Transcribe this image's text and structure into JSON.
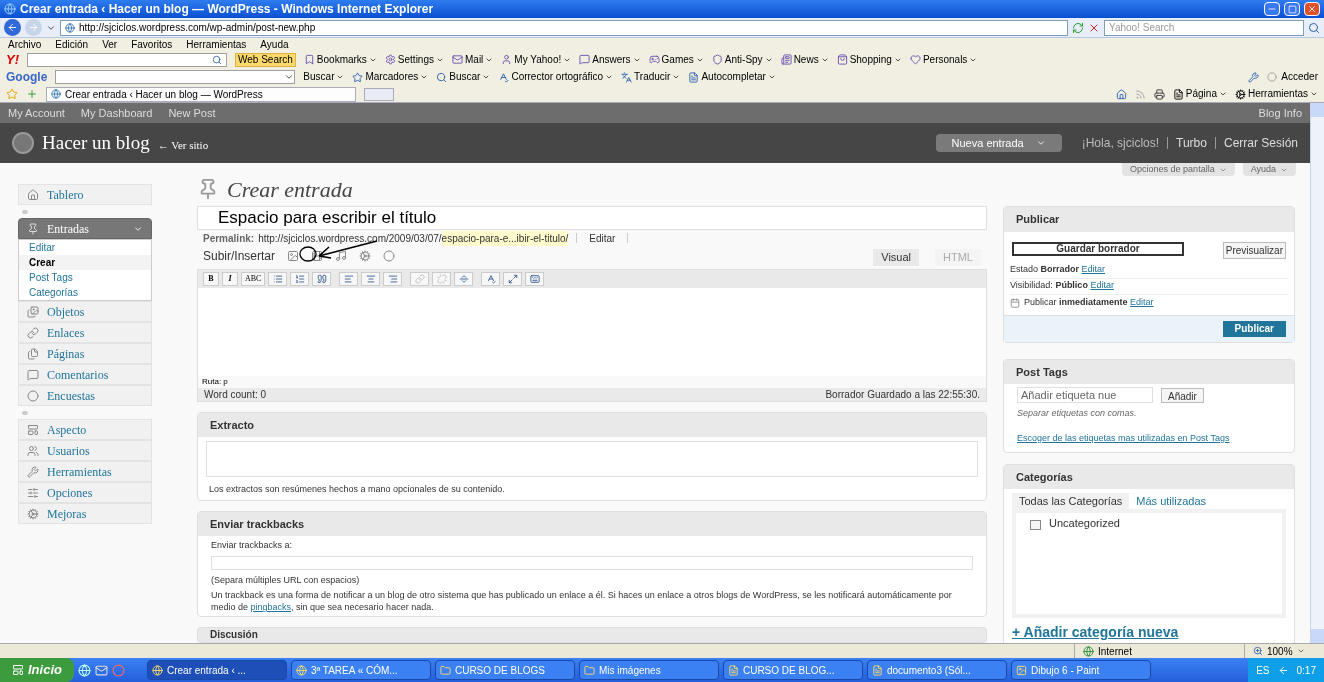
{
  "browser": {
    "title": "Crear entrada ‹ Hacer un blog — WordPress - Windows Internet Explorer",
    "address": "http://sjciclos.wordpress.com/wp-admin/post-new.php",
    "search_placeholder": "Yahoo! Search",
    "menu": [
      "Archivo",
      "Edición",
      "Ver",
      "Favoritos",
      "Herramientas",
      "Ayuda"
    ],
    "yahoo_logo": "Y!",
    "web_search": "Web Search",
    "yahoo_toolbar": [
      "Bookmarks",
      "Settings",
      "Mail",
      "My Yahoo!",
      "Answers",
      "Games",
      "Anti-Spy",
      "News",
      "Shopping",
      "Personals"
    ],
    "google_logo": "Google",
    "google_toolbar": [
      "Buscar",
      "Marcadores",
      "Buscar",
      "Corrector ortográfico",
      "Traducir",
      "Autocompletar"
    ],
    "sign_in": "Acceder",
    "tab": "Crear entrada ‹ Hacer un blog — WordPress",
    "command_bar": [
      "Página",
      "Herramientas"
    ]
  },
  "admin_bar": {
    "left": [
      "My Account",
      "My Dashboard",
      "New Post"
    ],
    "right": "Blog Info"
  },
  "header": {
    "blog_title": "Hacer un blog",
    "view_site": "← Ver sitio",
    "new_post": "Nueva entrada",
    "greeting": "¡Hola, sjciclos!",
    "links": [
      "Turbo",
      "Cerrar Sesión"
    ]
  },
  "screen_options": [
    "Opciones de pantalla",
    "Ayuda"
  ],
  "sidebar": {
    "groups": [
      [
        {
          "label": "Tablero",
          "expanded": false
        }
      ],
      [
        {
          "label": "Entradas",
          "expanded": true,
          "children": [
            {
              "label": "Editar",
              "selected": false
            },
            {
              "label": "Crear",
              "selected": true
            },
            {
              "label": "Post Tags",
              "selected": false
            },
            {
              "label": "Categorías",
              "selected": false
            }
          ]
        },
        {
          "label": "Objetos",
          "expanded": false
        },
        {
          "label": "Enlaces",
          "expanded": false
        },
        {
          "label": "Páginas",
          "expanded": false
        },
        {
          "label": "Comentarios",
          "expanded": false
        },
        {
          "label": "Encuestas",
          "expanded": false
        }
      ],
      [
        {
          "label": "Aspecto",
          "expanded": false
        },
        {
          "label": "Usuarios",
          "expanded": false
        },
        {
          "label": "Herramientas",
          "expanded": false
        },
        {
          "label": "Opciones",
          "expanded": false
        },
        {
          "label": "Mejoras",
          "expanded": false
        }
      ]
    ]
  },
  "post": {
    "heading": "Crear entrada",
    "title_value": "Espacio para escribir el título",
    "permalink_label": "Permalink:",
    "permalink_base": "http://sjciclos.wordpress.com/2009/03/07/",
    "permalink_slug": "espacio-para-e...ibir-el-titulo/",
    "permalink_edit": "Editar",
    "upload_label": "Subir/Insertar",
    "editor_tabs": [
      {
        "label": "Visual",
        "selected": true
      },
      {
        "label": "HTML",
        "selected": false
      }
    ],
    "format_buttons": [
      "B",
      "I",
      "ABC"
    ],
    "path": "Ruta: p",
    "word_count": "Word count: 0",
    "saved": "Borrador Guardado a las 22:55:30."
  },
  "excerpt": {
    "title": "Extracto",
    "note": "Los extractos son resúmenes hechos a mano opcionales de su contenido."
  },
  "trackbacks": {
    "title": "Enviar trackbacks",
    "label": "Enviar trackbacks a:",
    "hint": "(Separa múltiples URL con espacios)",
    "text_before": "Un trackback es una forma de notificar a un blog de otro sistema que has publicado un enlace a él. Si haces un enlace a otros blogs de WordPress, se les notificará automáticamente por medio de ",
    "link": "pingbacks",
    "text_after": ", sin que sea necesario hacer nada."
  },
  "discussion": {
    "title": "Discusión"
  },
  "publish": {
    "title": "Publicar",
    "save": "Guardar borrador",
    "preview": "Previsualizar",
    "rows": [
      {
        "text": "Estado **Borrador**",
        "link": "Editar"
      },
      {
        "text": "Visibilidad: **Público**",
        "link": "Editar"
      },
      {
        "text": "Publicar **inmediatamente**",
        "link": "Editar"
      }
    ],
    "button": "Publicar"
  },
  "tags": {
    "title": "Post Tags",
    "placeholder": "Añadir etiqueta nue",
    "add": "Añadir",
    "hint": "Separar etiquetas con comas.",
    "link": "Escoger de las etiquetas mas utilizadas en Post Tags"
  },
  "categories": {
    "title": "Categorías",
    "tabs": [
      {
        "label": "Todas las Categorías",
        "selected": true
      },
      {
        "label": "Más utilizadas",
        "selected": false
      }
    ],
    "items": [
      {
        "label": "Uncategorized",
        "checked": false
      }
    ],
    "add_link": "+ Añadir categoría nueva"
  },
  "status_bar": {
    "zone": "Internet",
    "zoom": "100%"
  },
  "taskbar": {
    "start": "Inicio",
    "tasks": [
      {
        "label": "Crear entrada ‹ ...",
        "selected": true
      },
      {
        "label": "3ª TAREA « CÓM...",
        "selected": false
      },
      {
        "label": "CURSO DE BLOGS",
        "selected": false
      },
      {
        "label": "Mis imágenes",
        "selected": false
      },
      {
        "label": "CURSO DE BLOG...",
        "selected": false
      },
      {
        "label": "documento3 (Sól...",
        "selected": false
      },
      {
        "label": "Dibujo 6 - Paint",
        "selected": false
      }
    ],
    "lang": "ES",
    "clock": "0:17"
  }
}
